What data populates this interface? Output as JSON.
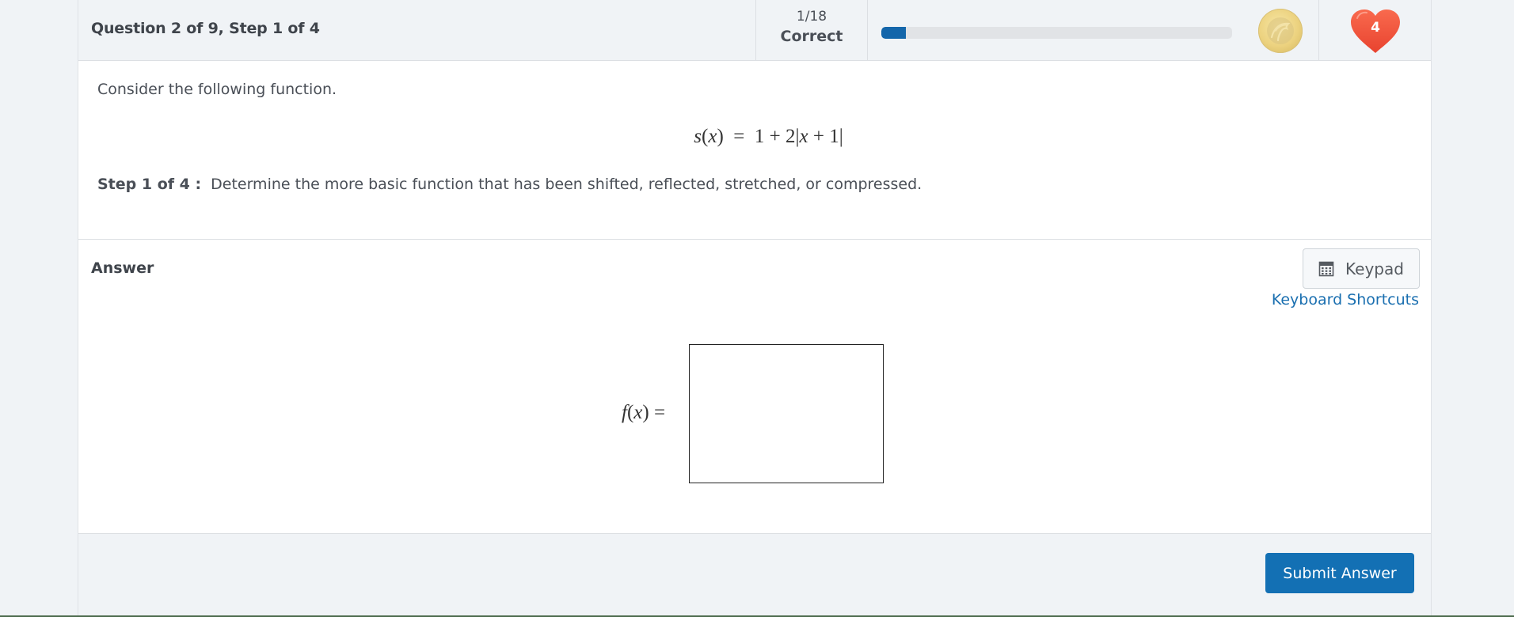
{
  "header": {
    "title": "Question 2 of 9, Step 1 of 4",
    "score": {
      "count": "1/18",
      "label": "Correct"
    },
    "progress": {
      "completed": 1,
      "total": 18,
      "fraction": 0.0556,
      "fill_color": "#1466aa"
    },
    "coin_icon": "eagle-coin-icon",
    "lives": {
      "count": "4",
      "icon": "heart-icon",
      "color": "#f04a32"
    }
  },
  "question": {
    "intro": "Consider the following function.",
    "equation": {
      "lhs_name": "s",
      "lhs_var": "x",
      "rhs": "1 + 2|x + 1|",
      "rhs_parts": [
        "1 + 2|",
        "x",
        " + 1|"
      ]
    },
    "step_label": "Step 1 of 4 :",
    "step_text": "Determine the more basic function that has been shifted, reflected, stretched, or compressed."
  },
  "answer": {
    "title": "Answer",
    "keypad_label": "Keypad",
    "keypad_icon": "calculator-icon",
    "shortcuts_link": "Keyboard Shortcuts",
    "input_label": {
      "name": "f",
      "var": "x",
      "equals": "="
    },
    "input_value": ""
  },
  "footer": {
    "submit_label": "Submit Answer",
    "submit_color": "#1370b4"
  }
}
